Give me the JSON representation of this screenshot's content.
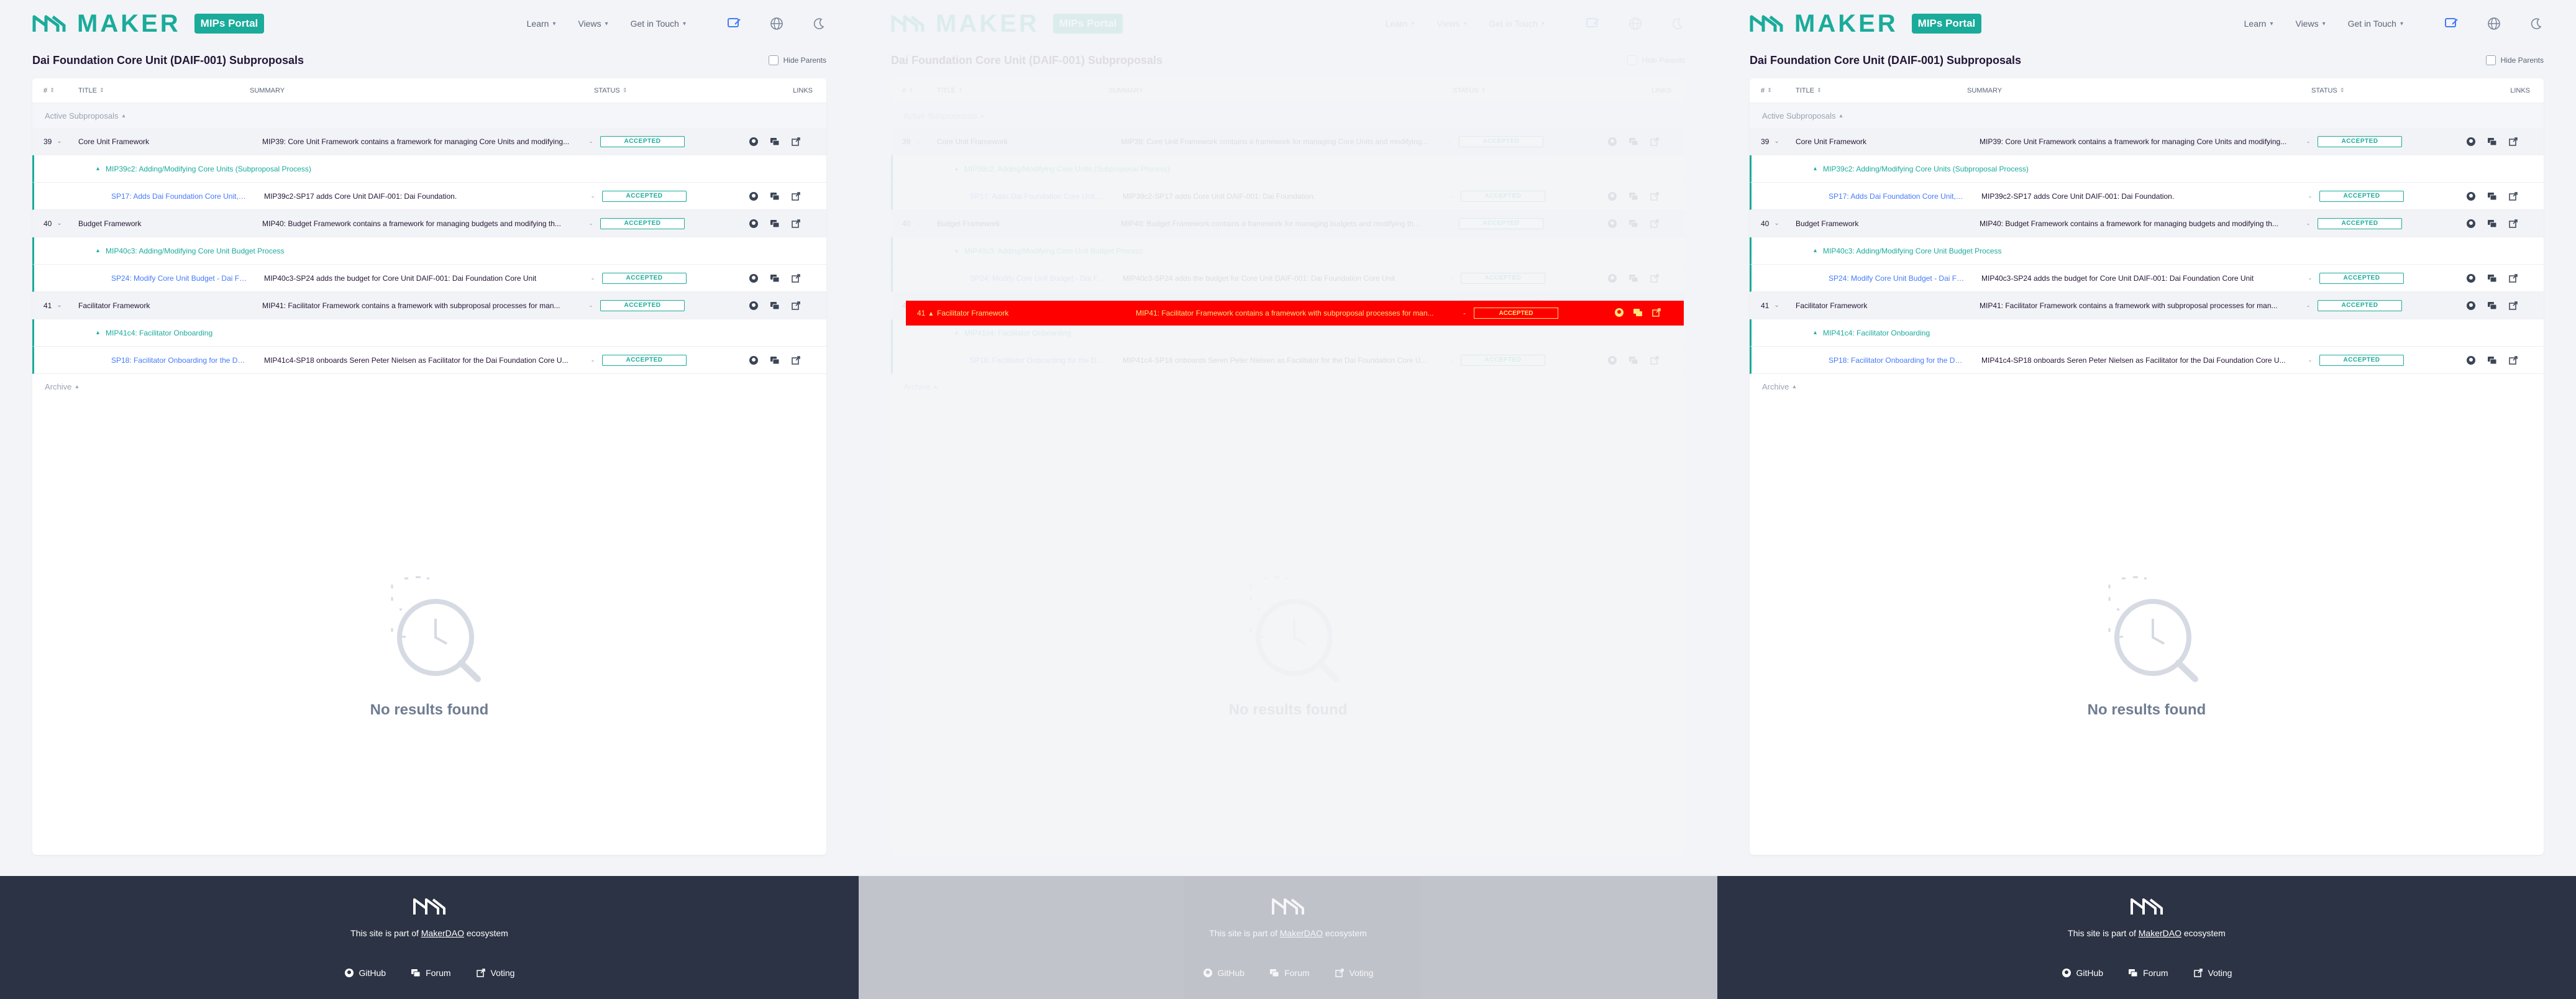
{
  "header": {
    "logo_text": "MAKER",
    "badge": "MIPs Portal",
    "nav": [
      {
        "label": "Learn"
      },
      {
        "label": "Views"
      },
      {
        "label": "Get in Touch"
      }
    ]
  },
  "page": {
    "title": "Dai Foundation Core Unit (DAIF-001) Subproposals",
    "hide_parents": "Hide Parents"
  },
  "table": {
    "headers": {
      "num": "#",
      "title": "TITLE",
      "summary": "SUMMARY",
      "status": "STATUS",
      "links": "LINKS"
    },
    "active_section": "Active Subproposals",
    "archive_section": "Archive",
    "rows": [
      {
        "type": "parent",
        "num": "39",
        "title": "Core Unit Framework",
        "summary": "MIP39: Core Unit Framework contains a framework for managing Core Units and modifying...",
        "status": "ACCEPTED"
      },
      {
        "type": "process",
        "title": "MIP39c2: Adding/Modifying Core Units (Subproposal Process)"
      },
      {
        "type": "sub",
        "title": "SP17: Adds Dai Foundation Core Unit, D...",
        "summary": "MIP39c2-SP17 adds Core Unit DAIF-001: Dai Foundation.",
        "status": "ACCEPTED"
      },
      {
        "type": "parent",
        "num": "40",
        "title": "Budget Framework",
        "summary": "MIP40: Budget Framework contains a framework for managing budgets and modifying th...",
        "status": "ACCEPTED"
      },
      {
        "type": "process",
        "title": "MIP40c3: Adding/Modifying Core Unit Budget Process"
      },
      {
        "type": "sub",
        "title": "SP24: Modify Core Unit Budget - Dai Fo...",
        "summary": "MIP40c3-SP24 adds the budget for Core Unit DAIF-001: Dai Foundation Core Unit",
        "status": "ACCEPTED"
      },
      {
        "type": "parent",
        "num": "41",
        "title": "Facilitator Framework",
        "summary": "MIP41: Facilitator Framework contains a framework with subproposal processes for man...",
        "status": "ACCEPTED"
      },
      {
        "type": "process",
        "title": "MIP41c4: Facilitator Onboarding"
      },
      {
        "type": "sub",
        "title": "SP18: Facilitator Onboarding for the Da...",
        "summary": "MIP41c4-SP18 onboards Seren Peter Nielsen as Facilitator for the Dai Foundation Core U...",
        "status": "ACCEPTED"
      }
    ],
    "dash": "-"
  },
  "empty": {
    "text": "No results found"
  },
  "footer": {
    "prefix": "This site is part of",
    "brand": "MakerDAO",
    "suffix": "ecosystem",
    "links": [
      {
        "label": "GitHub"
      },
      {
        "label": "Forum"
      },
      {
        "label": "Voting"
      }
    ]
  },
  "highlight": {
    "num": "41",
    "title": "Facilitator Framework",
    "summary": "MIP41: Facilitator Framework contains a framework with subproposal processes for man...",
    "status": "ACCEPTED"
  },
  "colors": {
    "accent": "#1aab9b",
    "link": "#447afb",
    "highlight": "#ff0000",
    "footer": "#2c3344"
  }
}
